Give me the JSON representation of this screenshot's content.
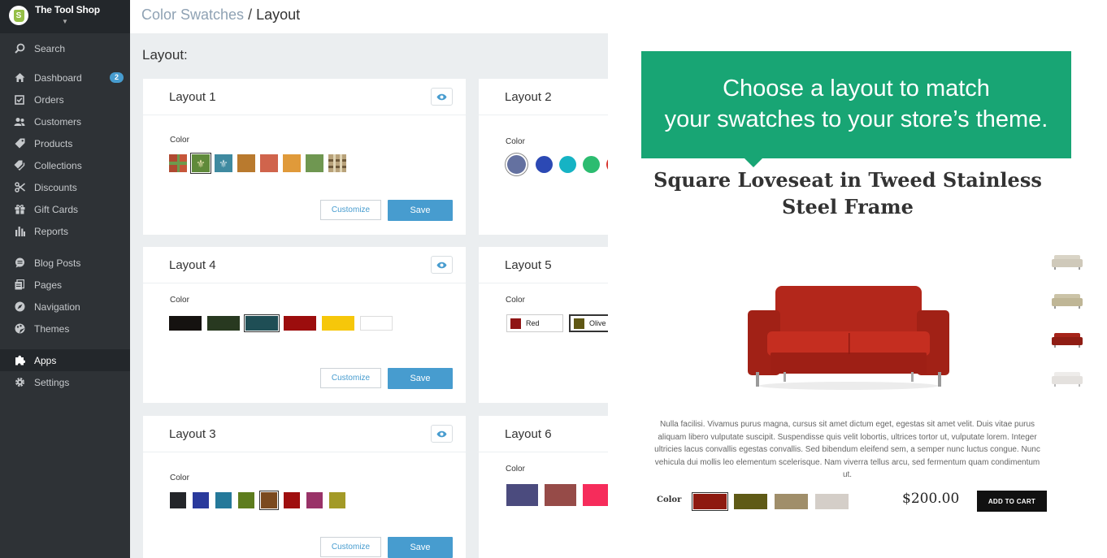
{
  "sidebar": {
    "store_name": "The Tool Shop",
    "items": [
      {
        "label": "Search",
        "icon": "search-icon"
      },
      {
        "label": "Dashboard",
        "icon": "home-icon",
        "badge": "2"
      },
      {
        "label": "Orders",
        "icon": "orders-icon"
      },
      {
        "label": "Customers",
        "icon": "customers-icon"
      },
      {
        "label": "Products",
        "icon": "tag-icon"
      },
      {
        "label": "Collections",
        "icon": "collections-icon"
      },
      {
        "label": "Discounts",
        "icon": "discounts-icon"
      },
      {
        "label": "Gift Cards",
        "icon": "gift-icon"
      },
      {
        "label": "Reports",
        "icon": "reports-icon"
      },
      {
        "label": "Blog Posts",
        "icon": "blog-icon"
      },
      {
        "label": "Pages",
        "icon": "pages-icon"
      },
      {
        "label": "Navigation",
        "icon": "navigation-icon"
      },
      {
        "label": "Themes",
        "icon": "themes-icon"
      },
      {
        "label": "Apps",
        "icon": "apps-icon"
      },
      {
        "label": "Settings",
        "icon": "settings-icon"
      }
    ]
  },
  "header": {
    "breadcrumb_parent": "Color Swatches",
    "separator": "/",
    "breadcrumb_current": "Layout"
  },
  "section_title": "Layout:",
  "cards": {
    "color_label": "Color",
    "customize_label": "Customize",
    "save_label": "Save",
    "layout1": {
      "title": "Layout 1"
    },
    "layout2": {
      "title": "Layout 2"
    },
    "layout3": {
      "title": "Layout 3"
    },
    "layout4": {
      "title": "Layout 4"
    },
    "layout5": {
      "title": "Layout 5",
      "tags": [
        "Red",
        "Olive Gr"
      ]
    },
    "layout6": {
      "title": "Layout 6"
    }
  },
  "colors": {
    "layout2": [
      "#6471a0",
      "#2c49b4",
      "#16b3c4",
      "#2cbc70",
      "#d7322b"
    ],
    "layout3": [
      "#24262a",
      "#2a3a9c",
      "#25799a",
      "#5e7d1e",
      "#7b4a1f",
      "#9f0f0f",
      "#993368",
      "#a39a27"
    ],
    "layout4": [
      "#151210",
      "#283920",
      "#1f4e55",
      "#9c0d0d",
      "#f6c70a",
      "#ffffff"
    ],
    "layout5": [
      "#8f1515",
      "#5f5714"
    ],
    "layout6": [
      "#4b4b7e",
      "#964b48",
      "#f62c5b"
    ],
    "accent": "#479ccf",
    "promo_green": "#18a574"
  },
  "promo": {
    "headline_line1": "Choose a layout to match",
    "headline_line2": "your swatches to your store’s theme.",
    "product_title": "Square Loveseat in Tweed Stainless Steel Frame",
    "description": "Nulla facilisi. Vivamus purus magna, cursus sit amet dictum eget, egestas sit amet velit. Duis vitae purus aliquam libero vulputate suscipit. Suspendisse quis velit lobortis, ultrices tortor ut, vulputate lorem. Integer ultricies lacus convallis egestas convallis. Sed bibendum eleifend sem, a semper nunc luctus congue. Nunc vehicula dui mollis leo elementum scelerisque. Nam viverra tellus arcu, sed fermentum quam condimentum ut.",
    "color_label": "Color",
    "swatches": [
      "#8e1a10",
      "#5f5a16",
      "#a08e6a",
      "#d4cec8"
    ],
    "price": "$200.00",
    "cart_label": "ADD TO CART"
  }
}
